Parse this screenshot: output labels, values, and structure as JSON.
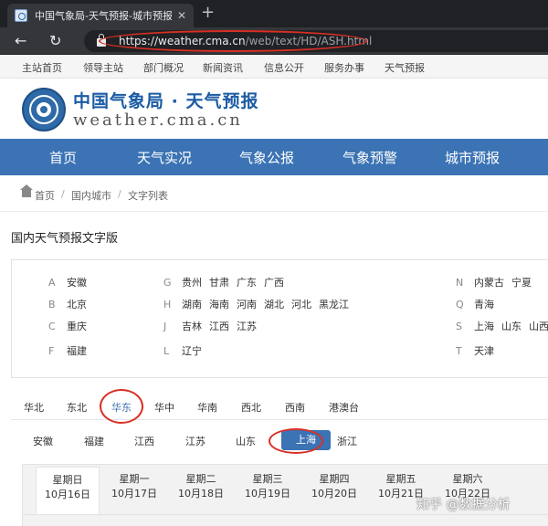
{
  "browser": {
    "tab_title": "中国气象局-天气预报-城市预报",
    "tab_close": "✕",
    "new_tab": "+",
    "back": "←",
    "reload": "↻",
    "url_main": "https://weather.cma.cn",
    "url_path": "/web/text/HD/ASH.html",
    "annotation_color": "#d93025"
  },
  "toplinks": [
    "主站首页",
    "领导主站",
    "部门概况",
    "新闻资讯",
    "信息公开",
    "服务办事",
    "天气预报"
  ],
  "header": {
    "site_name": "中国气象局 · 天气预报",
    "site_domain": "weather.cma.cn",
    "brand_color": "#1c5ba3"
  },
  "mainnav": [
    "首页",
    "天气实况",
    "气象公报",
    "气象预警",
    "城市预报"
  ],
  "breadcrumb": [
    "首页",
    "国内城市",
    "文字列表"
  ],
  "page_title": "国内天气预报文字版",
  "provinces": {
    "col1": [
      {
        "letter": "A",
        "names": [
          "安徽"
        ]
      },
      {
        "letter": "B",
        "names": [
          "北京"
        ]
      },
      {
        "letter": "C",
        "names": [
          "重庆"
        ]
      },
      {
        "letter": "F",
        "names": [
          "福建"
        ]
      }
    ],
    "col2": [
      {
        "letter": "G",
        "names": [
          "贵州",
          "甘肃",
          "广东",
          "广西"
        ]
      },
      {
        "letter": "H",
        "names": [
          "湖南",
          "海南",
          "河南",
          "湖北",
          "河北",
          "黑龙江"
        ]
      },
      {
        "letter": "J",
        "names": [
          "吉林",
          "江西",
          "江苏"
        ]
      },
      {
        "letter": "L",
        "names": [
          "辽宁"
        ]
      }
    ],
    "col3": [
      {
        "letter": "N",
        "names": [
          "内蒙古",
          "宁夏"
        ]
      },
      {
        "letter": "Q",
        "names": [
          "青海"
        ]
      },
      {
        "letter": "S",
        "names": [
          "上海",
          "山东",
          "山西"
        ]
      },
      {
        "letter": "T",
        "names": [
          "天津"
        ]
      }
    ]
  },
  "regions": [
    "华北",
    "东北",
    "华东",
    "华中",
    "华南",
    "西北",
    "西南",
    "港澳台"
  ],
  "active_region": "华东",
  "cities": [
    "安徽",
    "福建",
    "江西",
    "江苏",
    "山东",
    "上海",
    "浙江"
  ],
  "active_city": "上海",
  "days": [
    {
      "weekday": "星期日",
      "date": "10月16日"
    },
    {
      "weekday": "星期一",
      "date": "10月17日"
    },
    {
      "weekday": "星期二",
      "date": "10月18日"
    },
    {
      "weekday": "星期三",
      "date": "10月19日"
    },
    {
      "weekday": "星期四",
      "date": "10月20日"
    },
    {
      "weekday": "星期五",
      "date": "10月21日"
    },
    {
      "weekday": "星期六",
      "date": "10月22日"
    }
  ],
  "watermark": "知乎 @数据分析"
}
